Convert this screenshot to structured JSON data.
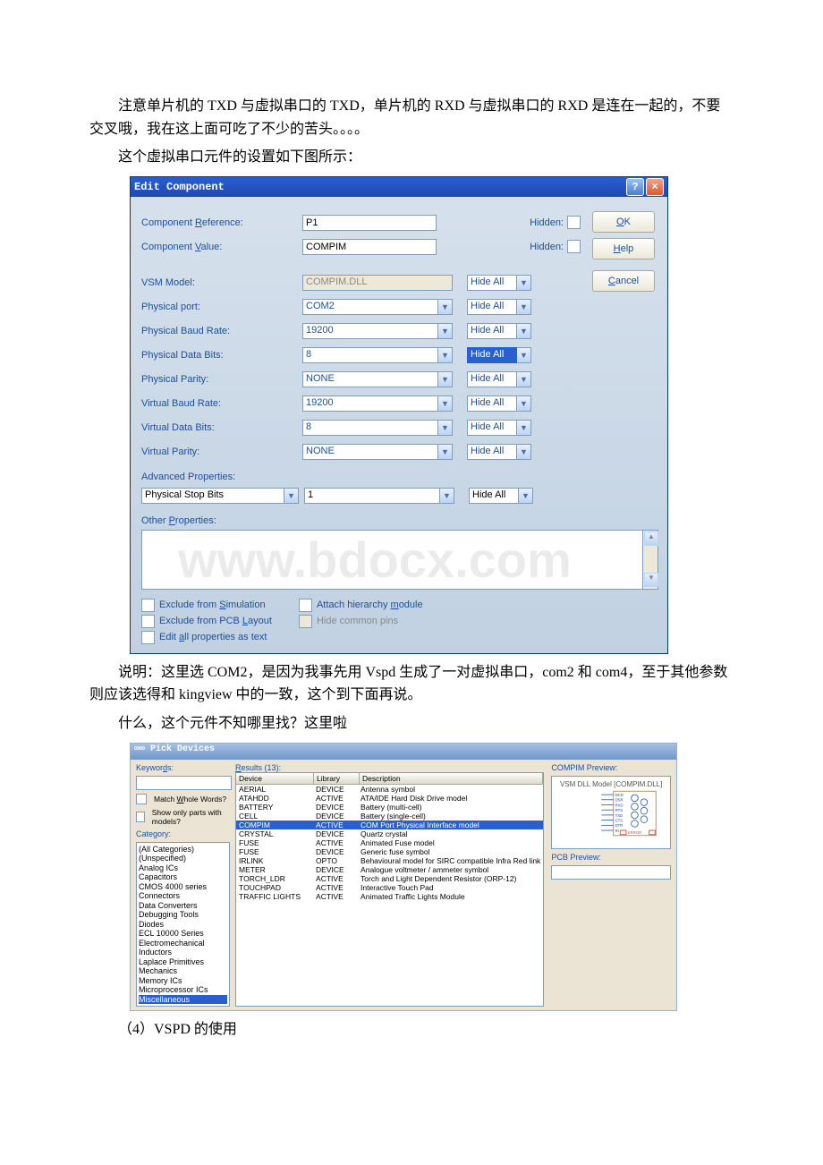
{
  "text": {
    "p1": "注意单片机的 TXD 与虚拟串口的 TXD，单片机的 RXD 与虚拟串口的 RXD 是连在一起的，不要交叉哦，我在这上面可吃了不少的苦头。。。。",
    "p2": "这个虚拟串口元件的设置如下图所示：",
    "p3": "说明：这里选 COM2，是因为我事先用 Vspd 生成了一对虚拟串口，com2 和 com4，至于其他参数则应该选得和 kingview 中的一致，这个到下面再说。",
    "p4": "什么，这个元件不知哪里找？这里啦",
    "p5": "（4）VSPD 的使用"
  },
  "watermark": "www.bdocx.com",
  "dialog": {
    "title": "Edit Component",
    "buttons": {
      "ok": "OK",
      "help": "Help",
      "cancel": "Cancel"
    },
    "labels": {
      "ref": "Component Reference:",
      "val": "Component Value:",
      "vsm": "VSM Model:",
      "port": "Physical port:",
      "pbaud": "Physical Baud Rate:",
      "pdata": "Physical Data Bits:",
      "pparity": "Physical Parity:",
      "vbaud": "Virtual Baud Rate:",
      "vdata": "Virtual Data Bits:",
      "vparity": "Virtual Parity:",
      "adv": "Advanced Properties:",
      "advprop": "Physical Stop Bits",
      "other": "Other Properties:",
      "hidden": "Hidden:",
      "hideall": "Hide All",
      "ex_sim": "Exclude from Simulation",
      "ex_pcb": "Exclude from PCB Layout",
      "edit_all": "Edit all properties as text",
      "attach": "Attach hierarchy module",
      "hidepins": "Hide common pins"
    },
    "values": {
      "ref": "P1",
      "val": "COMPIM",
      "vsm": "COMPIM.DLL",
      "port": "COM2",
      "pbaud": "19200",
      "pdata": "8",
      "pparity": "NONE",
      "vbaud": "19200",
      "vdata": "8",
      "vparity": "NONE",
      "advval": "1"
    }
  },
  "pick": {
    "title": "Pick Devices",
    "left": {
      "keywords": "Keywords:",
      "match": "Match Whole Words?",
      "only": "Show only parts with models?",
      "category": "Category:",
      "cats": [
        "(All Categories)",
        "(Unspecified)",
        "Analog ICs",
        "Capacitors",
        "CMOS 4000 series",
        "Connectors",
        "Data Converters",
        "Debugging Tools",
        "Diodes",
        "ECL 10000 Series",
        "Electromechanical",
        "Inductors",
        "Laplace Primitives",
        "Mechanics",
        "Memory ICs",
        "Microprocessor ICs",
        "Miscellaneous"
      ]
    },
    "mid": {
      "results": "Results (13):",
      "headers": {
        "device": "Device",
        "library": "Library",
        "desc": "Description"
      },
      "rows": [
        [
          "AERIAL",
          "DEVICE",
          "Antenna symbol"
        ],
        [
          "ATAHDD",
          "ACTIVE",
          "ATA/IDE Hard Disk Drive model"
        ],
        [
          "BATTERY",
          "DEVICE",
          "Battery (multi-cell)"
        ],
        [
          "CELL",
          "DEVICE",
          "Battery (single-cell)"
        ],
        [
          "COMPIM",
          "ACTIVE",
          "COM Port Physical Interface model"
        ],
        [
          "CRYSTAL",
          "DEVICE",
          "Quartz crystal"
        ],
        [
          "FUSE",
          "ACTIVE",
          "Animated Fuse model"
        ],
        [
          "FUSE",
          "DEVICE",
          "Generic fuse symbol"
        ],
        [
          "IRLINK",
          "OPTO",
          "Behavioural model for SIRC compatible Infra Red link"
        ],
        [
          "METER",
          "DEVICE",
          "Analogue voltmeter / ammeter symbol"
        ],
        [
          "TORCH_LDR",
          "ACTIVE",
          "Torch and Light Dependent Resistor (ORP-12)"
        ],
        [
          "TOUCHPAD",
          "ACTIVE",
          "Interactive Touch Pad"
        ],
        [
          "TRAFFIC LIGHTS",
          "ACTIVE",
          "Animated Traffic Lights Module"
        ]
      ]
    },
    "right": {
      "preview": "COMPIM Preview:",
      "vsm": "VSM DLL Model [COMPIM.DLL]",
      "pins": [
        "DCD",
        "DSR",
        "RXD",
        "RTS",
        "TXD",
        "CTS",
        "DTR",
        "RI"
      ],
      "error": "ERROR",
      "pcb": "PCB Preview:"
    }
  }
}
